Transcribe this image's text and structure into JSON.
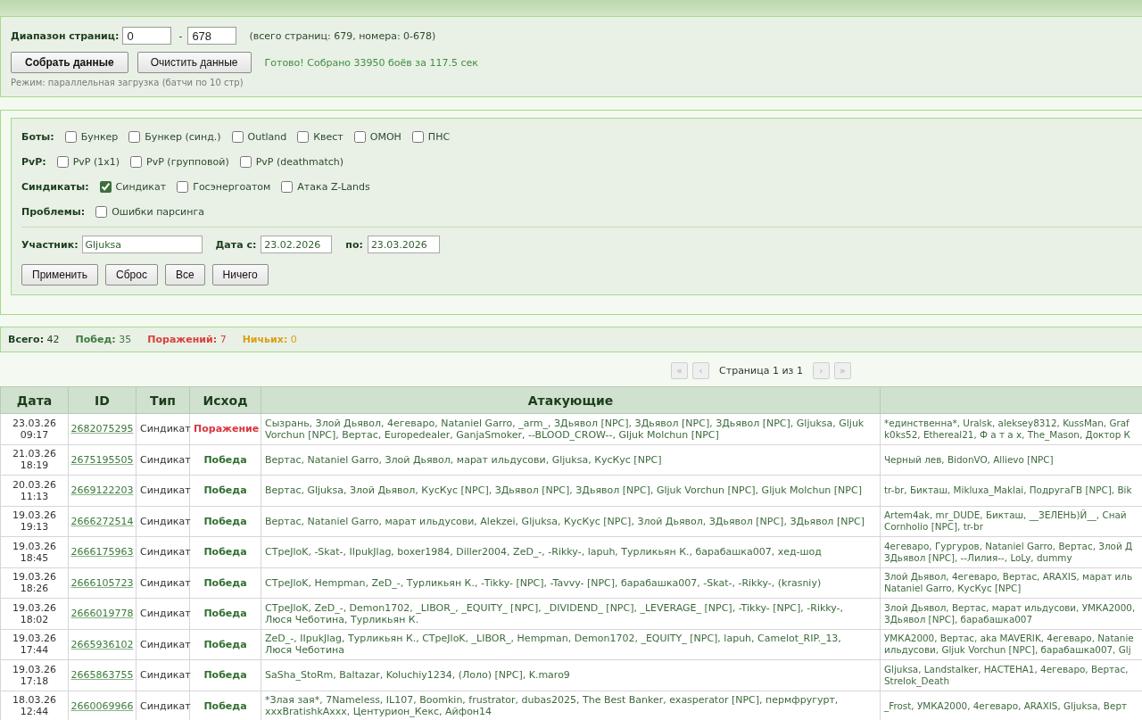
{
  "range_panel": {
    "label": "Диапазон страниц:",
    "from": "0",
    "separator": "-",
    "to": "678",
    "info": "(всего страниц: 679, номера: 0-678)",
    "buttons": [
      {
        "label": "Собрать данные",
        "primary": true
      },
      {
        "label": "Очистить данные",
        "primary": false
      }
    ],
    "status": "Готово! Собрано 33950 боёв за 117.5 сек",
    "mode_note": "Режим: параллельная загрузка (батчи по 10 стр)"
  },
  "filters": {
    "groups": [
      {
        "label": "Боты:",
        "options": [
          {
            "label": "Бункер",
            "checked": false
          },
          {
            "label": "Бункер (синд.)",
            "checked": false
          },
          {
            "label": "Outland",
            "checked": false
          },
          {
            "label": "Квест",
            "checked": false
          },
          {
            "label": "ОМОН",
            "checked": false
          },
          {
            "label": "ПНС",
            "checked": false
          }
        ]
      },
      {
        "label": "PvP:",
        "options": [
          {
            "label": "PvP (1x1)",
            "checked": false
          },
          {
            "label": "PvP (групповой)",
            "checked": false
          },
          {
            "label": "PvP (deathmatch)",
            "checked": false
          }
        ]
      },
      {
        "label": "Синдикаты:",
        "options": [
          {
            "label": "Синдикат",
            "checked": true
          },
          {
            "label": "Госэнергоатом",
            "checked": false
          },
          {
            "label": "Атака Z-Lands",
            "checked": false
          }
        ]
      },
      {
        "label": "Проблемы:",
        "options": [
          {
            "label": "Ошибки парсинга",
            "checked": false
          }
        ]
      }
    ],
    "participant": {
      "label": "Участник:",
      "value": "Gljuksa"
    },
    "date_from": {
      "label": "Дата с:",
      "value": "23.02.2026"
    },
    "date_to": {
      "label": "по:",
      "value": "23.03.2026"
    },
    "buttons": [
      "Применить",
      "Сброс",
      "Все",
      "Ничего"
    ]
  },
  "stats": [
    {
      "label": "Всего:",
      "value": "42",
      "color": "#1f3f1f"
    },
    {
      "label": "Побед:",
      "value": "35",
      "color": "#3d7a3d"
    },
    {
      "label": "Поражений:",
      "value": "7",
      "color": "#d9403a"
    },
    {
      "label": "Ничьих:",
      "value": "0",
      "color": "#d9a016"
    }
  ],
  "pagination": {
    "before": [
      {
        "label": "«",
        "disabled": true
      },
      {
        "label": "‹",
        "disabled": true
      }
    ],
    "page_text": "Страница 1 из 1",
    "after": [
      {
        "label": "›",
        "disabled": true
      },
      {
        "label": "»",
        "disabled": true
      }
    ]
  },
  "table": {
    "columns": [
      "Дата",
      "ID",
      "Тип",
      "Исход",
      "Атакующие"
    ],
    "rows": [
      {
        "datetime": "23.03.26 09:17",
        "id": "2682075295",
        "type": "Синдикат",
        "outcome": {
          "kind": "loss",
          "label": "Поражение"
        },
        "attackers": "Сызрань, Злой Дьявол, 4егеваро, Nataniel Garro, _arm_, ЗДьявол [NPC], ЗДьявол [NPC], ЗДьявол [NPC], Gljuksa, Gljuk Vorchun [NPC], Вертас, Europedealer, GanjaSmoker, --BLOOD_CROW--, Gljuk Molchun [NPC]",
        "column_6": [
          "*единственна*, Uralsk, aleksey8312, KussMan, Graf",
          "k0ks52, Ethereal21, Ф а т а х, The_Mason, Доктор К"
        ]
      },
      {
        "datetime": "21.03.26 18:19",
        "id": "2675195505",
        "type": "Синдикат",
        "outcome": {
          "kind": "win",
          "label": "Победа"
        },
        "attackers": "Вертас, Nataniel Garro, Злой Дьявол, марат ильдусови, Gljuksa, КусКус [NPC]",
        "column_6": [
          "Черный лев, BidonVO, Allievo [NPC]"
        ]
      },
      {
        "datetime": "20.03.26 11:13",
        "id": "2669122203",
        "type": "Синдикат",
        "outcome": {
          "kind": "win",
          "label": "Победа"
        },
        "attackers": "Вертас, Gljuksa, Злой Дьявол, КусКус [NPC], ЗДьявол [NPC], ЗДьявол [NPC], Gljuk Vorchun [NPC], Gljuk Molchun [NPC]",
        "column_6": [
          "tr-br, Бикташ, Mikluxa_Maklai, ПодругаГВ [NPC], Bik"
        ]
      },
      {
        "datetime": "19.03.26 19:13",
        "id": "2666272514",
        "type": "Синдикат",
        "outcome": {
          "kind": "win",
          "label": "Победа"
        },
        "attackers": "Вертас, Nataniel Garro, марат ильдусови, Alekzei, Gljuksa, КусКус [NPC], Злой Дьявол, ЗДьявол [NPC], ЗДьявол [NPC]",
        "column_6": [
          "Artem4ak, mr_DUDE, Бикташ, __ЗЕЛЕНЬ)Й__, Снай",
          "Cornholio [NPC], tr-br"
        ]
      },
      {
        "datetime": "19.03.26 18:45",
        "id": "2666175963",
        "type": "Синдикат",
        "outcome": {
          "kind": "win",
          "label": "Победа"
        },
        "attackers": "CTpeJloK, -Skat-, IIpukJlag, boxer1984, Diller2004, ZeD_-, -Rikky-, lapuh, Турликьян К., барабашка007, хед-шод",
        "column_6": [
          "4егеваро, Гургуров, Nataniel Garro, Вертас, Злой Д",
          "ЗДьявол [NPC], --Лилия--, LoLy, dummy"
        ]
      },
      {
        "datetime": "19.03.26 18:26",
        "id": "2666105723",
        "type": "Синдикат",
        "outcome": {
          "kind": "win",
          "label": "Победа"
        },
        "attackers": "CTpeJloK, Hempman, ZeD_-, Турликьян К., -Tikky- [NPC], -Tavvy- [NPC], барабашка007, -Skat-, -Rikky-, (krasniy)",
        "column_6": [
          "Злой Дьявол, 4егеваро, Вертас, ARAXIS, марат иль",
          "Nataniel Garro, КусКус [NPC]"
        ]
      },
      {
        "datetime": "19.03.26 18:02",
        "id": "2666019778",
        "type": "Синдикат",
        "outcome": {
          "kind": "win",
          "label": "Победа"
        },
        "attackers": "CTpeJloK, ZeD_-, Demon1702, _LIBOR_, _EQUITY_ [NPC], _DIVIDEND_ [NPC], _LEVERAGE_ [NPC], -Tikky- [NPC], -Rikky-, Люся Чеботина, Турликьян К.",
        "column_6": [
          "Злой Дьявол, Вертас, марат ильдусови, УМКА2000,",
          "ЗДьявол [NPC], барабашка007"
        ]
      },
      {
        "datetime": "19.03.26 17:44",
        "id": "2665936102",
        "type": "Синдикат",
        "outcome": {
          "kind": "win",
          "label": "Победа"
        },
        "attackers": "ZeD_-, IIpukJlag, Турликьян К., CTpeJloK, _LIBOR_, Hempman, Demon1702, _EQUITY_ [NPC], lapuh, Camelot_RIP._13, Люся Чеботина",
        "column_6": [
          "УМКА2000, Вертас, aka MAVERIK, 4егеваро, Natanie",
          "ильдусови, Gljuk Vorchun [NPC], барабашка007, Glj"
        ]
      },
      {
        "datetime": "19.03.26 17:18",
        "id": "2665863755",
        "type": "Синдикат",
        "outcome": {
          "kind": "win",
          "label": "Победа"
        },
        "attackers": "SaSha_StoRm, Baltazar, Koluchiy1234, (Лоло) [NPC], K.maro9",
        "column_6": [
          "Gljuksa, Landstalker, НАСТЕНА1, 4егеваро, Вертас,",
          "Strelok_Death"
        ]
      },
      {
        "datetime": "18.03.26 12:44",
        "id": "2660069966",
        "type": "Синдикат",
        "outcome": {
          "kind": "win",
          "label": "Победа"
        },
        "attackers": "*Злая зая*, 7Nameless, IL107, Boomkin, frustrator, dubas2025, The Best Banker, exasperator [NPC], пермфругурт, xxxBratishkAxxx, Центурион_Кекс, Айфон14",
        "column_6": [
          "_Frost, УМКА2000, 4егеваро, ARAXIS, Gljuksa, Верт"
        ]
      }
    ]
  }
}
